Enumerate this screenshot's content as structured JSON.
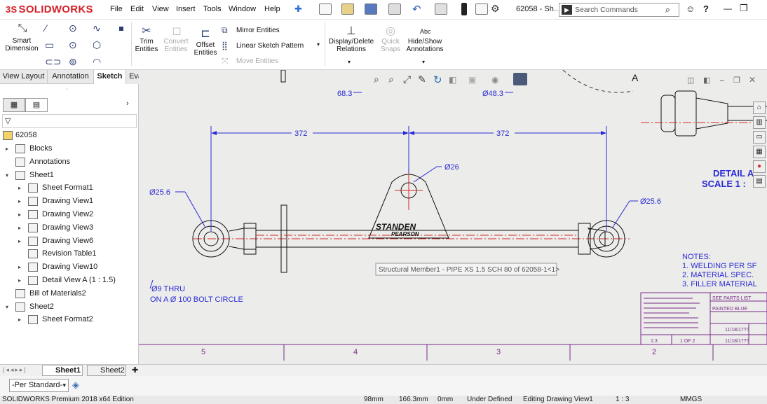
{
  "app": {
    "brand": "SOLIDWORKS",
    "brand_prefix": "3S",
    "doc_title": "62058 - Sh..."
  },
  "menus": [
    "File",
    "Edit",
    "View",
    "Insert",
    "Tools",
    "Window",
    "Help"
  ],
  "search": {
    "placeholder": "Search Commands"
  },
  "window_controls": {
    "user": "⌂",
    "help": "?",
    "minimize": "—",
    "restore": "❐",
    "pin": "★"
  },
  "ribbon": {
    "smart_dimension": "Smart\nDimension",
    "trim_entities": "Trim\nEntities",
    "convert_entities": "Convert\nEntities",
    "offset_entities": "Offset\nEntities",
    "mirror_entities": "Mirror Entities",
    "linear_pattern": "Linear Sketch Pattern",
    "move_entities": "Move Entities",
    "display_delete": "Display/Delete\nRelations",
    "quick_snaps": "Quick\nSnaps",
    "hide_show": "Hide/Show\nAnnotations",
    "abc": "Abc"
  },
  "command_tabs": [
    "View Layout",
    "Annotation",
    "Sketch",
    "Evaluate"
  ],
  "active_tab": "Sketch",
  "tree": {
    "root": "62058",
    "items": [
      {
        "label": "Blocks",
        "indent": 1,
        "arrow": "▸"
      },
      {
        "label": "Annotations",
        "indent": 1,
        "arrow": ""
      },
      {
        "label": "Sheet1",
        "indent": 1,
        "arrow": "▾"
      },
      {
        "label": "Sheet Format1",
        "indent": 2,
        "arrow": "▸"
      },
      {
        "label": "Drawing View1",
        "indent": 2,
        "arrow": "▸"
      },
      {
        "label": "Drawing View2",
        "indent": 2,
        "arrow": "▸"
      },
      {
        "label": "Drawing View3",
        "indent": 2,
        "arrow": "▸"
      },
      {
        "label": "Drawing View6",
        "indent": 2,
        "arrow": "▸"
      },
      {
        "label": "Revision Table1",
        "indent": 2,
        "arrow": ""
      },
      {
        "label": "Drawing View10",
        "indent": 2,
        "arrow": "▸"
      },
      {
        "label": "Detail View A (1 : 1.5)",
        "indent": 2,
        "arrow": "▸"
      },
      {
        "label": "Bill of Materials2",
        "indent": 1,
        "arrow": ""
      },
      {
        "label": "Sheet2",
        "indent": 1,
        "arrow": "▾"
      },
      {
        "label": "Sheet Format2",
        "indent": 2,
        "arrow": "▸"
      }
    ]
  },
  "drawing": {
    "dim_left": "372",
    "dim_right": "372",
    "dim_top_left": "68.3",
    "dim_top_right": "Ø48.3",
    "dim_hole": "Ø26",
    "dim_end_left": "Ø25.6",
    "dim_end_right": "Ø25.6",
    "bolt_note_1": "Ø9 THRU",
    "bolt_note_2": "ON A  Ø 100 BOLT CIRCLE",
    "logo_line1": "STANDEN",
    "logo_line2": "PEARSON",
    "tooltip": "Structural Member1 - PIPE XS 1.5 SCH 80 of 62058-1<1>",
    "detail_label_1": "DETAIL A",
    "detail_label_2": "SCALE 1 :",
    "section_letter": "A",
    "notes_title": "NOTES:",
    "notes": [
      "1.  WELDING PER SF",
      "2.  MATERIAL SPEC.",
      "3.  FILLER MATERIAL"
    ],
    "zones": [
      "5",
      "4",
      "3",
      "2"
    ],
    "title_block": {
      "finish": "SEE PARTS LIST",
      "paint": "PAINTED BLUE",
      "date1": "11/18/17??",
      "date2": "11/18/17??",
      "scale": "1:3",
      "sheet": "1 OF 2"
    }
  },
  "sheet_tabs": [
    "Sheet1",
    "Sheet2"
  ],
  "standard": "-Per Standard-",
  "status": {
    "edition": "SOLIDWORKS Premium 2018 x64 Edition",
    "x": "98mm",
    "y": "166.3mm",
    "z": "0mm",
    "state": "Under Defined",
    "editing": "Editing Drawing View1",
    "scale": "1 : 3",
    "units": "MMGS"
  },
  "colors": {
    "dim_blue": "#2b2bd6",
    "center_red": "#d42a2a",
    "zone_purple": "#7a2a8a",
    "brand_red": "#d42027"
  }
}
